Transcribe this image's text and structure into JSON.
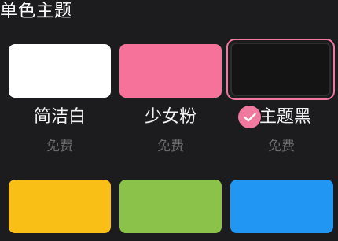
{
  "section": {
    "title": "单色主题"
  },
  "themes": [
    {
      "name": "简洁白",
      "price": "免费",
      "color": "#ffffff",
      "selected": false
    },
    {
      "name": "少女粉",
      "price": "免费",
      "color": "#f7729a",
      "selected": false
    },
    {
      "name": "主题黑",
      "price": "免费",
      "color": "#141414",
      "selected": true
    },
    {
      "name": "",
      "price": "",
      "color": "#f9bf16",
      "selected": false
    },
    {
      "name": "",
      "price": "",
      "color": "#8bc34a",
      "selected": false
    },
    {
      "name": "",
      "price": "",
      "color": "#2196f3",
      "selected": false
    }
  ],
  "accent": "#f07a9f",
  "icons": {
    "selected": "check-icon"
  }
}
